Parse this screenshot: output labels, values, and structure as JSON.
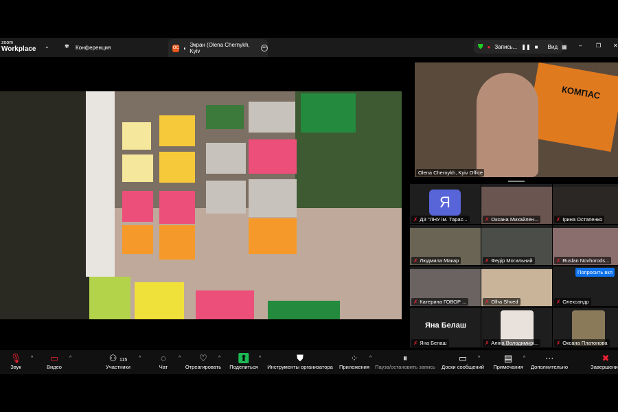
{
  "app": {
    "logo_small": "zoom",
    "logo_big": "Workplace",
    "meeting_label": "Конференция",
    "share_tab_label": "Экран (Olena Chernykh, Kyiv",
    "share_tab_badge": "OC",
    "record_label": "Запись...",
    "view_label": "Вид"
  },
  "speaker": {
    "name": "Olena Chernykh, Kyiv Office",
    "book_title": "КОМПАС"
  },
  "participants": [
    {
      "name": "ДЗ \"ЛНУ ім. Тарас...",
      "avatar": "Я",
      "color": "#5865d8"
    },
    {
      "name": "Оксана Михайлен...",
      "color": "#6a5550"
    },
    {
      "name": "Ірина Остапенко",
      "color": "#2b2724"
    },
    {
      "name": "Людмила Макар",
      "color": "#6a6455"
    },
    {
      "name": "Федір Могильний",
      "color": "#4a4d48"
    },
    {
      "name": "Ruslan Novhorods...",
      "color": "#8a6d6d"
    },
    {
      "name": "Катерина ГОВОР ...",
      "color": "#6a6362"
    },
    {
      "name": "Olha Shved",
      "color": "#c9b49a"
    },
    {
      "name": "Олександр",
      "color": "#1e1e1e"
    },
    {
      "name": "Яна Белаш",
      "big_name": "Яна Белаш",
      "color": "#1a1a1a"
    },
    {
      "name": "Аліна Володимирі...",
      "color": "#e9e2dc"
    },
    {
      "name": "Оксана Платонова",
      "color": "#8a7a5a"
    }
  ],
  "ask_button": "Попросить вкл",
  "participant_count": "115",
  "toolbar": [
    {
      "id": "audio",
      "label": "Звук",
      "icon": "mic-muted-icon"
    },
    {
      "id": "video",
      "label": "Видео",
      "icon": "video-off-icon"
    },
    {
      "id": "participants",
      "label": "Участники",
      "icon": "people-icon"
    },
    {
      "id": "chat",
      "label": "Чат",
      "icon": "chat-icon"
    },
    {
      "id": "react",
      "label": "Отреагировать",
      "icon": "heart-icon"
    },
    {
      "id": "share",
      "label": "Поделиться",
      "icon": "share-icon"
    },
    {
      "id": "host-tools",
      "label": "Инструменты организатора",
      "icon": "shield-icon"
    },
    {
      "id": "apps",
      "label": "Приложения",
      "icon": "apps-icon"
    },
    {
      "id": "record",
      "label": "Пауза/остановить запись",
      "icon": "pause-stop-icon"
    },
    {
      "id": "whiteboards",
      "label": "Доски сообщений",
      "icon": "whiteboard-icon"
    },
    {
      "id": "notes",
      "label": "Примечания",
      "icon": "notes-icon"
    },
    {
      "id": "more",
      "label": "Дополнительно",
      "icon": "more-icon"
    },
    {
      "id": "end",
      "label": "Завершение",
      "icon": "end-icon"
    }
  ]
}
